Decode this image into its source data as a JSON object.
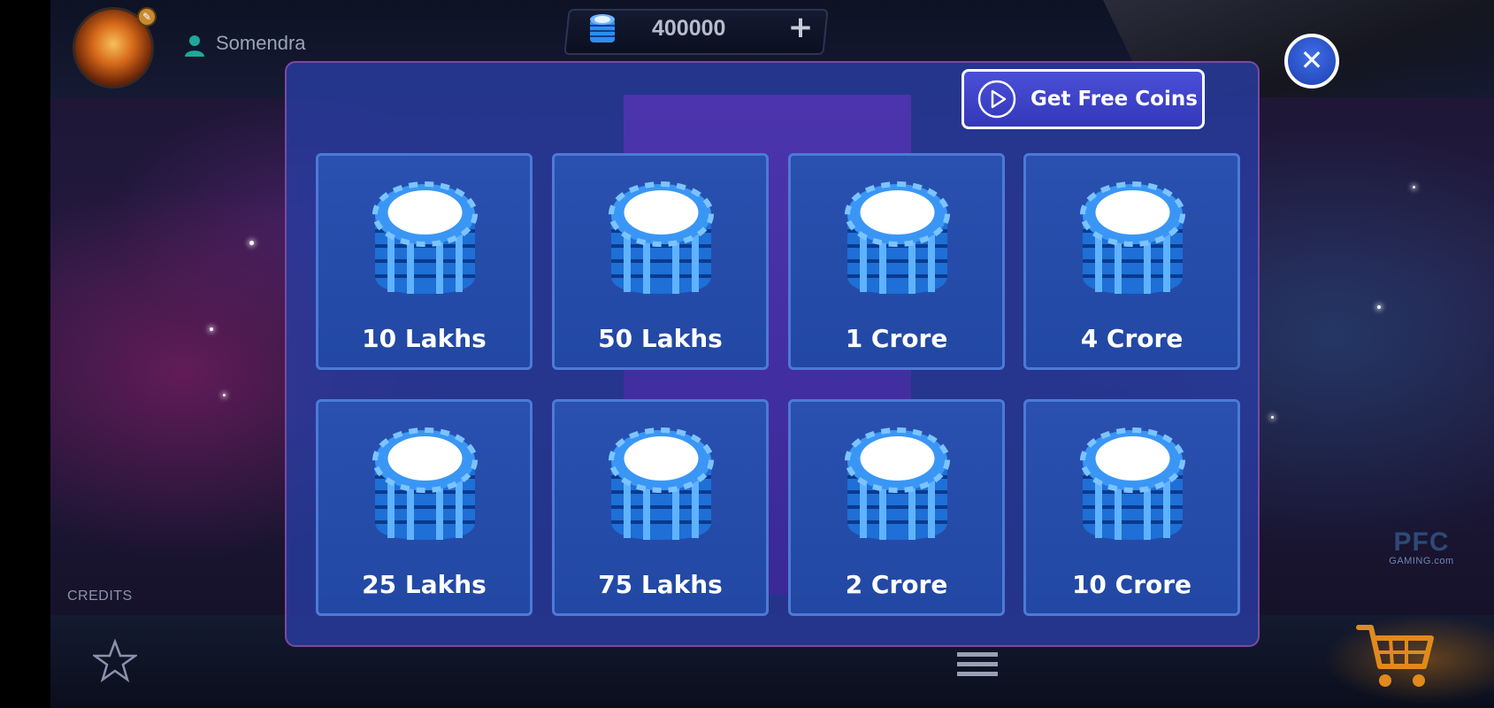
{
  "header": {
    "username": "Somendra",
    "balance": "400000",
    "add_label": "+"
  },
  "footer": {
    "credits_label": "CREDITS"
  },
  "logo": {
    "main": "PFC",
    "sub": "GAMING.com"
  },
  "modal": {
    "free_coins_label": "Get Free Coins",
    "close_label": "✕",
    "packages": [
      {
        "label": "10 Lakhs"
      },
      {
        "label": "50 Lakhs"
      },
      {
        "label": "1 Crore"
      },
      {
        "label": "4 Crore"
      },
      {
        "label": "25 Lakhs"
      },
      {
        "label": "75 Lakhs"
      },
      {
        "label": "2 Crore"
      },
      {
        "label": "10 Crore"
      }
    ]
  },
  "colors": {
    "modal_bg": "#2c46b0",
    "tile_bg": "#2a50b0",
    "chip_blue": "#2f8ef0",
    "button_bg": "#4a4fd8",
    "cart_orange": "#e08a1e"
  }
}
